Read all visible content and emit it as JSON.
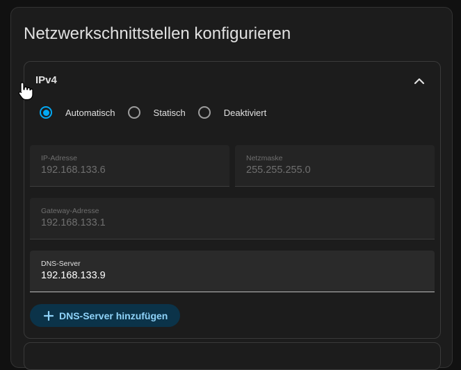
{
  "title": "Netzwerkschnittstellen konfigurieren",
  "ipv4": {
    "section_label": "IPv4",
    "modes": [
      {
        "label": "Automatisch",
        "checked": true
      },
      {
        "label": "Statisch",
        "checked": false
      },
      {
        "label": "Deaktiviert",
        "checked": false
      }
    ],
    "ip_address": {
      "label": "IP-Adresse",
      "value": "192.168.133.6"
    },
    "netmask": {
      "label": "Netzmaske",
      "value": "255.255.255.0"
    },
    "gateway": {
      "label": "Gateway-Adresse",
      "value": "192.168.133.1"
    },
    "dns": {
      "label": "DNS-Server",
      "value": "192.168.133.9"
    },
    "add_dns_label": "DNS-Server hinzufügen"
  },
  "colors": {
    "accent": "#03a9f4",
    "button_bg": "#0b3349",
    "button_text": "#8fd3f9"
  },
  "icons": {
    "collapse": "chevron-up-icon",
    "add": "plus-icon",
    "pointer": "hand-pointer-icon"
  }
}
